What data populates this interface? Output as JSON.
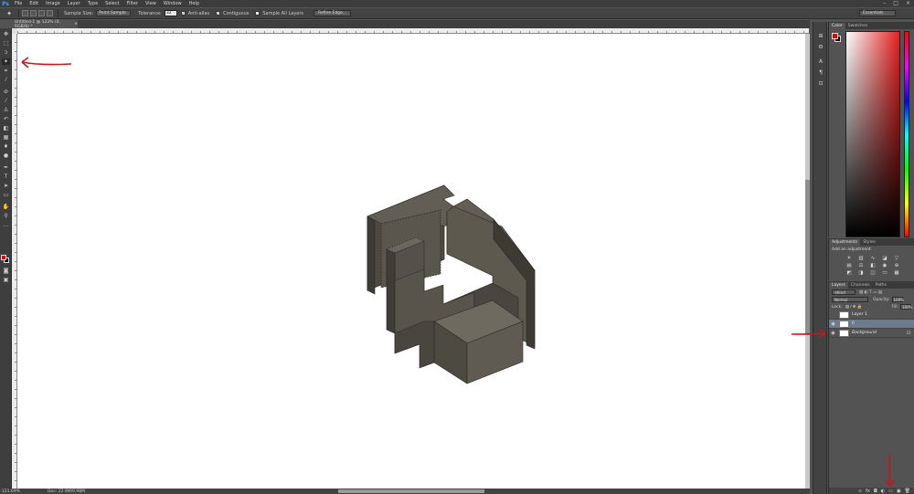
{
  "app": {
    "logo": "Ps",
    "menu": [
      "File",
      "Edit",
      "Image",
      "Layer",
      "Type",
      "Select",
      "Filter",
      "View",
      "Window",
      "Help"
    ],
    "window_controls": [
      "–",
      "□",
      "×"
    ]
  },
  "options_bar": {
    "tool_icon": "magic-wand-icon",
    "sample_size_label": "Sample Size:",
    "sample_size_value": "Point Sample",
    "tolerance_label": "Tolerance:",
    "tolerance_value": "32",
    "anti_alias_label": "Anti-alias",
    "contiguous_label": "Contiguous",
    "sample_all_label": "Sample All Layers",
    "refine_edge_label": "Refine Edge...",
    "workspace": "Essentials"
  },
  "document": {
    "tab_title": "Untitled-1 @ 122% (0, RGB/8) *",
    "status_zoom": "121.69%",
    "status_doc": "Doc: 22.9M/9.98M"
  },
  "panels": {
    "color_tabs": [
      "Color",
      "Swatches"
    ],
    "adjustments_tabs": [
      "Adjustments",
      "Styles"
    ],
    "adjustments_title": "Add an adjustment",
    "layers_tabs": [
      "Layers",
      "Channels",
      "Paths"
    ],
    "kind_label": "Kind",
    "blend_mode": "Normal",
    "opacity_label": "Opacity:",
    "opacity_value": "100%",
    "lock_label": "Lock:",
    "fill_label": "Fill:",
    "fill_value": "100%",
    "layers": [
      {
        "name": "Layer 1",
        "visible": false,
        "selected": false,
        "locked": false
      },
      {
        "name": "0",
        "visible": true,
        "selected": true,
        "locked": false
      },
      {
        "name": "Background",
        "visible": true,
        "selected": false,
        "locked": true
      }
    ]
  },
  "colors": {
    "foreground": "#e00000",
    "background": "#000000",
    "annotation_arrows": "#c8141e",
    "object_face": "#5f5b52"
  }
}
